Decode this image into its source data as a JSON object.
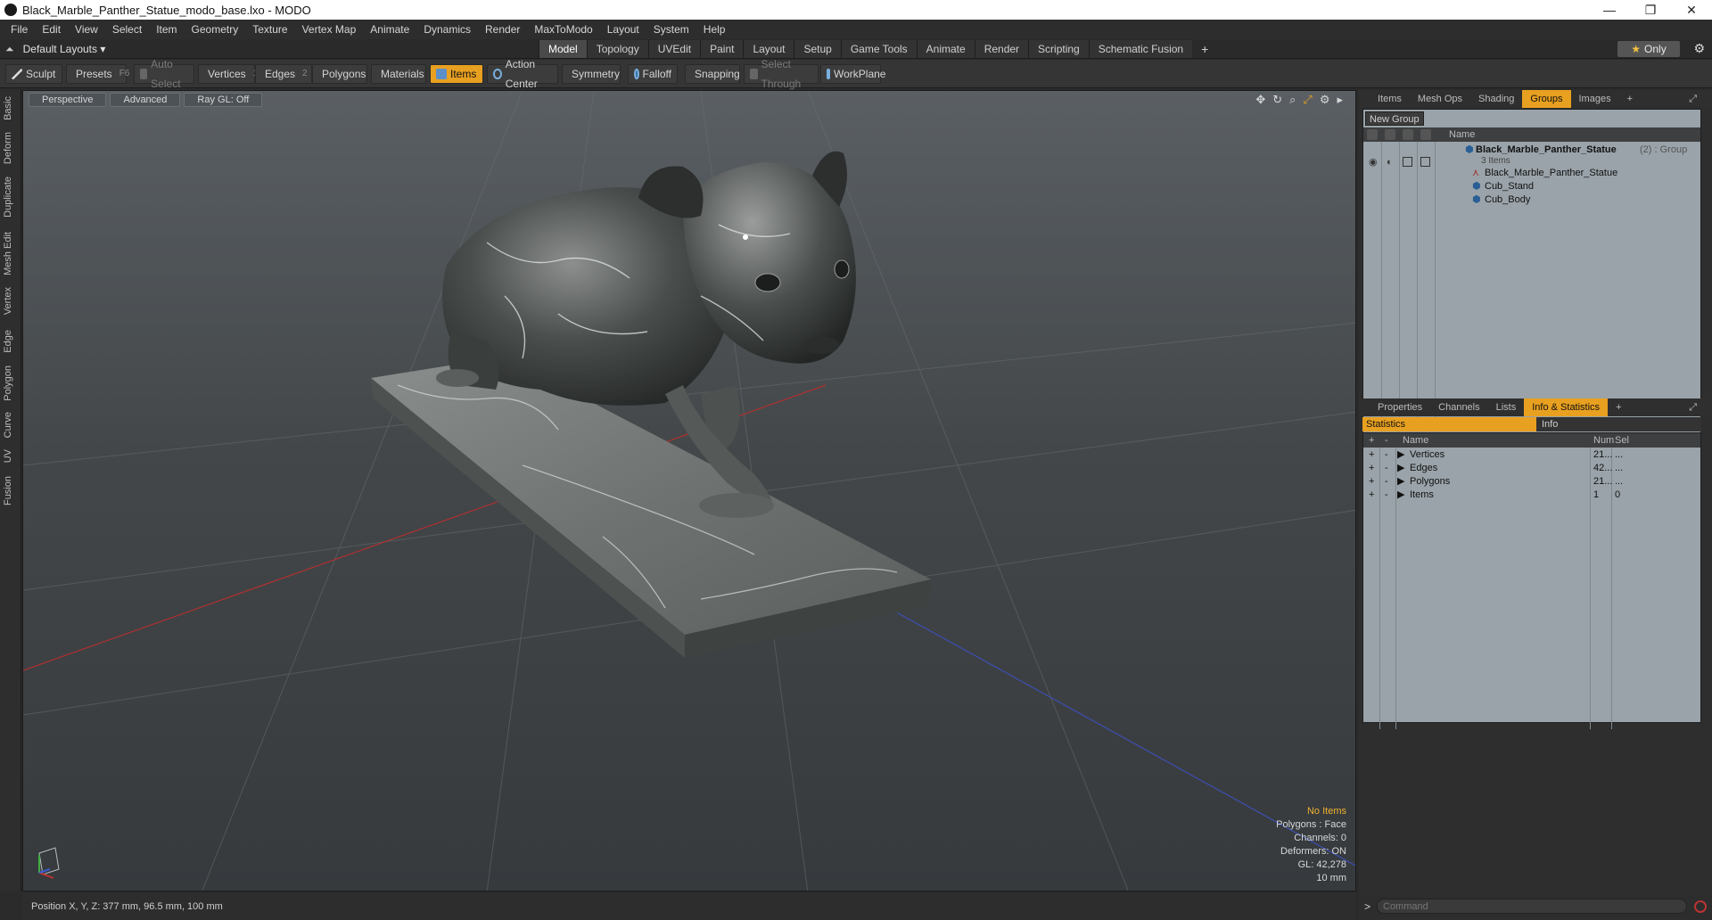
{
  "window": {
    "title": "Black_Marble_Panther_Statue_modo_base.lxo - MODO",
    "minimize": "—",
    "maximize": "❐",
    "close": "✕"
  },
  "menu": [
    "File",
    "Edit",
    "View",
    "Select",
    "Item",
    "Geometry",
    "Texture",
    "Vertex Map",
    "Animate",
    "Dynamics",
    "Render",
    "MaxToModo",
    "Layout",
    "System",
    "Help"
  ],
  "layoutbar": {
    "layout_label": "Default Layouts ▾",
    "tabs": [
      "Model",
      "Topology",
      "UVEdit",
      "Paint",
      "Layout",
      "Setup",
      "Game Tools",
      "Animate",
      "Render",
      "Scripting",
      "Schematic Fusion"
    ],
    "active_tab": "Model",
    "plus": "+",
    "only_star": "★",
    "only_label": "Only"
  },
  "toolbar": {
    "sculpt": "Sculpt",
    "presets": "Presets",
    "presets_key": "F6",
    "auto_select": "Auto Select",
    "vertices": "Vertices",
    "vertices_count": "1",
    "edges": "Edges",
    "edges_count": "2",
    "polygons": "Polygons",
    "materials": "Materials",
    "items": "Items",
    "action_center": "Action Center",
    "symmetry": "Symmetry",
    "falloff": "Falloff",
    "snapping": "Snapping",
    "select_through": "Select Through",
    "workplane": "WorkPlane"
  },
  "lefttabs": [
    "Basic",
    "Deform",
    "Duplicate",
    "Mesh Edit",
    "Vertex",
    "Edge",
    "Polygon",
    "Curve",
    "UV",
    "Fusion"
  ],
  "viewport": {
    "view_mode": "Perspective",
    "shading": "Advanced",
    "raygl": "Ray GL: Off",
    "overlay": {
      "no_items": "No Items",
      "polygons": "Polygons : Face",
      "channels": "Channels: 0",
      "deformers": "Deformers: ON",
      "gl": "GL: 42,278",
      "unit": "10 mm"
    }
  },
  "statusbar": {
    "position": "Position X, Y, Z:  377 mm, 96.5 mm, 100 mm"
  },
  "top_panel": {
    "tabs": [
      "Items",
      "Mesh Ops",
      "Shading",
      "Groups",
      "Images"
    ],
    "active_tab": "Groups",
    "plus": "+",
    "new_group": "New Group",
    "name_header": "Name",
    "group_name": "Black_Marble_Panther_Statue",
    "group_suffix": "(2) : Group",
    "group_items": "3 Items",
    "children": [
      "Black_Marble_Panther_Statue",
      "Cub_Stand",
      "Cub_Body"
    ]
  },
  "bottom_panel": {
    "tabs": [
      "Properties",
      "Channels",
      "Lists",
      "Info & Statistics"
    ],
    "active_tab": "Info & Statistics",
    "plus": "+",
    "statistics_tab": "Statistics",
    "info_tab": "Info",
    "headers": {
      "name": "Name",
      "num": "Num",
      "sel": "Sel"
    },
    "rows": [
      {
        "name": "Vertices",
        "num": "21...",
        "sel": "..."
      },
      {
        "name": "Edges",
        "num": "42...",
        "sel": "..."
      },
      {
        "name": "Polygons",
        "num": "21...",
        "sel": "..."
      },
      {
        "name": "Items",
        "num": "1",
        "sel": "0"
      }
    ]
  },
  "command": {
    "prompt": ">",
    "placeholder": "Command"
  },
  "colors": {
    "accent": "#e8a020",
    "panel_bg": "#9aa3a9",
    "viewport_top": "#5a5f64",
    "viewport_bottom": "#363a3d"
  }
}
